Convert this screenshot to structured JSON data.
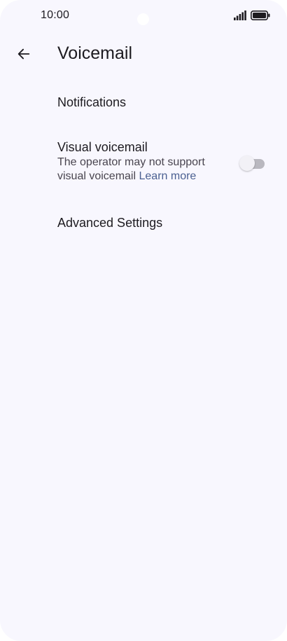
{
  "status_bar": {
    "time": "10:00",
    "icons": [
      "signal-icon",
      "battery-icon"
    ]
  },
  "app_bar": {
    "back_icon": "arrow-left-icon",
    "title": "Voicemail"
  },
  "settings": {
    "notifications": {
      "title": "Notifications"
    },
    "visual_voicemail": {
      "title": "Visual voicemail",
      "summary": "The operator may not support visual voicemail",
      "link": "Learn more",
      "enabled": false
    },
    "advanced": {
      "title": "Advanced Settings"
    }
  },
  "colors": {
    "background": "#f8f7fe",
    "text_primary": "#1d1b20",
    "text_secondary": "#49454f",
    "link": "#4a5f91",
    "toggle_track_off": "#b9b8bf"
  }
}
